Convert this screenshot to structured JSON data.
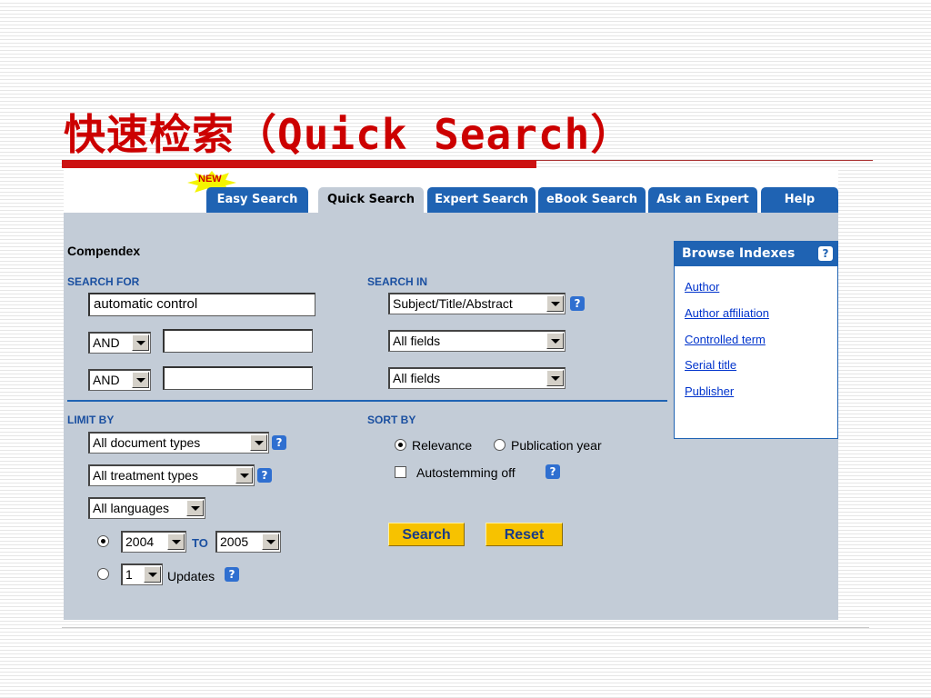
{
  "slide": {
    "title": "快速检索（Quick Search）"
  },
  "tabs": {
    "new_badge": "NEW",
    "items": [
      {
        "label": "Easy Search"
      },
      {
        "label": "Quick Search"
      },
      {
        "label": "Expert Search"
      },
      {
        "label": "eBook Search"
      },
      {
        "label": "Ask an Expert"
      },
      {
        "label": "Help"
      }
    ],
    "active": "Quick Search"
  },
  "form": {
    "database": "Compendex",
    "search_for_label": "SEARCH FOR",
    "search_in_label": "SEARCH IN",
    "rows": [
      {
        "term": "automatic control",
        "field": "Subject/Title/Abstract"
      },
      {
        "operator": "AND",
        "term": "",
        "field": "All fields"
      },
      {
        "operator": "AND",
        "term": "",
        "field": "All fields"
      }
    ],
    "limit_by_label": "LIMIT BY",
    "document_type": "All document types",
    "treatment_type": "All treatment types",
    "language": "All languages",
    "year_from": "2004",
    "to_label": "TO",
    "year_to": "2005",
    "updates_count": "1",
    "updates_label": "Updates",
    "sort_by_label": "SORT BY",
    "sort_options": [
      "Relevance",
      "Publication year"
    ],
    "sort_selected": "Relevance",
    "autostemming_label": "Autostemming off",
    "search_button": "Search",
    "reset_button": "Reset",
    "help_glyph": "?"
  },
  "browse_indexes": {
    "title": "Browse Indexes",
    "links": [
      "Author",
      "Author affiliation",
      "Controlled term",
      "Serial title",
      "Publisher"
    ]
  },
  "colors": {
    "title_red": "#cc0000",
    "tab_blue": "#1f63b3",
    "panel_gray": "#c3ccd7",
    "button_yellow": "#f7c200",
    "link_blue": "#0033cc"
  }
}
